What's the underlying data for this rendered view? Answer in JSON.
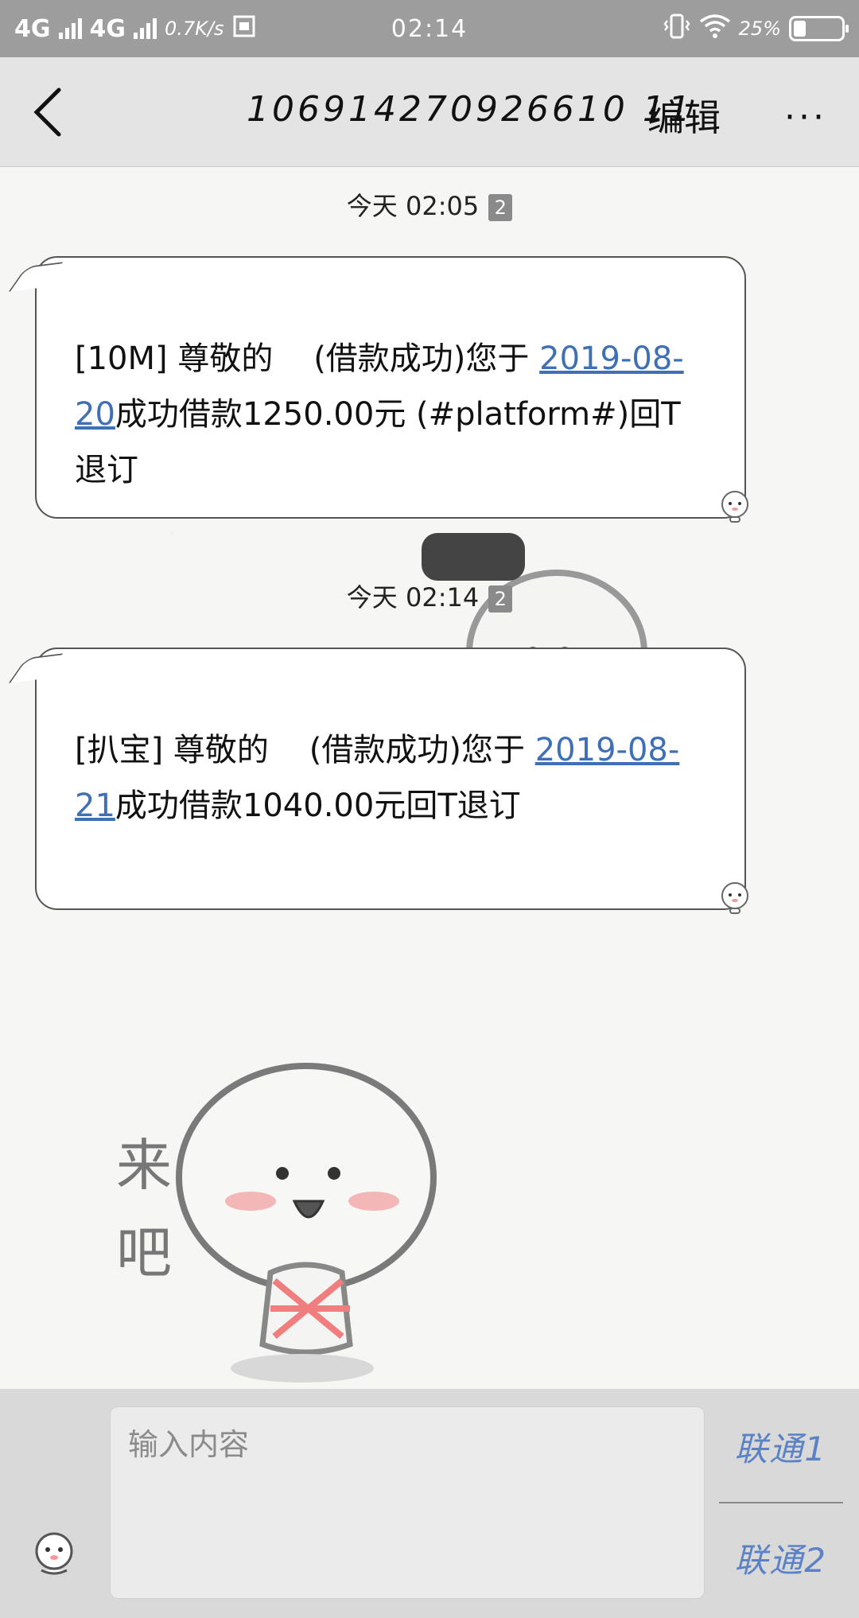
{
  "status_bar": {
    "network1": "4G",
    "network2": "4G",
    "speed": "0.7K/s",
    "time": "02:14",
    "battery_text": "25%",
    "battery_level": 0.25
  },
  "header": {
    "title": "106914270926610 11",
    "edit_label": "编辑",
    "more_label": "···"
  },
  "messages": [
    {
      "timestamp": "今天 02:05",
      "sim": "2",
      "text_before": "[10M] 尊敬的",
      "text_mid": "(借款成功)您于",
      "date": "2019-08-20",
      "text_after": "成功借款1250.00元 (#platform#)回T退订"
    },
    {
      "timestamp": "今天 02:14",
      "sim": "2",
      "text_before": "[扒宝] 尊敬的",
      "text_mid": "(借款成功)您于",
      "date": "2019-08-21",
      "text_after": "成功借款1040.00元回T退订"
    }
  ],
  "decoration": {
    "sticker_text": "来吧"
  },
  "input": {
    "placeholder": "输入内容",
    "sim1_label": "联通1",
    "sim2_label": "联通2"
  }
}
